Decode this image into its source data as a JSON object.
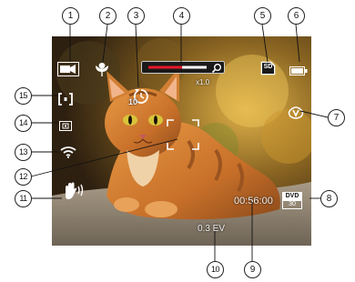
{
  "callouts": [
    "1",
    "2",
    "3",
    "4",
    "5",
    "6",
    "7",
    "8",
    "9",
    "10",
    "11",
    "12",
    "13",
    "14",
    "15"
  ],
  "overlay": {
    "self_timer_value": "10",
    "zoom_label": "x1.0",
    "zoom_level_fraction": 0.58,
    "card_label": "SD",
    "record_time": "00:56:00",
    "video_quality_top": "DVD",
    "video_quality_bottom": "30",
    "exposure_value": "0.3 EV",
    "battery_level_fraction": 1.0
  },
  "icons": {
    "mode": "video-camera-icon",
    "macro": "macro-flower-icon",
    "self_timer": "self-timer-icon",
    "zoom_bar": "zoom-bar",
    "zoom_search": "magnifier-icon",
    "sd_card": "sd-card-icon",
    "battery": "battery-icon",
    "smart_scene": "smart-scene-v-icon",
    "video_quality": "dvd-quality-icon",
    "stabilizer": "image-stabilizer-hand-icon",
    "focus_frame": "focus-frame",
    "wifi": "wifi-icon",
    "metering": "metering-center-icon",
    "af_mode": "af-single-point-icon"
  },
  "colors": {
    "zoom_fill": "#e8192c",
    "overlay_white": "#ffffff"
  }
}
